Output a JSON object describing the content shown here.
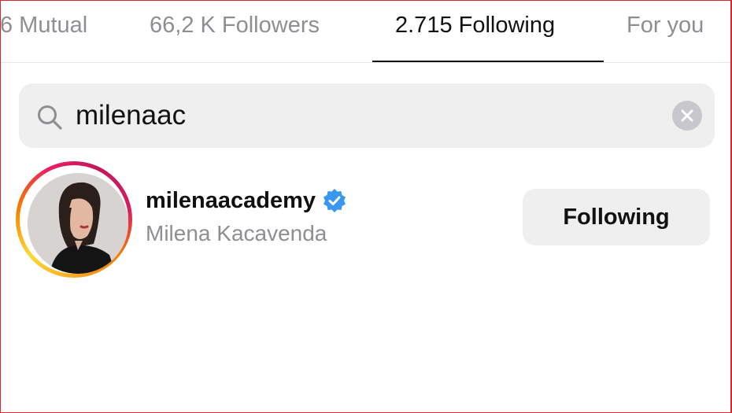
{
  "tabs": [
    {
      "label": "6 Mutual",
      "active": false
    },
    {
      "label": "66,2 K Followers",
      "active": false
    },
    {
      "label": "2.715 Following",
      "active": true
    },
    {
      "label": "For you",
      "active": false
    }
  ],
  "search": {
    "value": "milenaac",
    "icon": "search-icon",
    "clear_icon": "clear-icon"
  },
  "result": {
    "username": "milenaacademy",
    "verified": true,
    "full_name": "Milena Kacavenda",
    "button_label": "Following"
  },
  "colors": {
    "verified_blue": "#3897f0",
    "secondary_text": "#8e8e93",
    "field_bg": "#efeff0",
    "frame_border": "#d9262c"
  }
}
